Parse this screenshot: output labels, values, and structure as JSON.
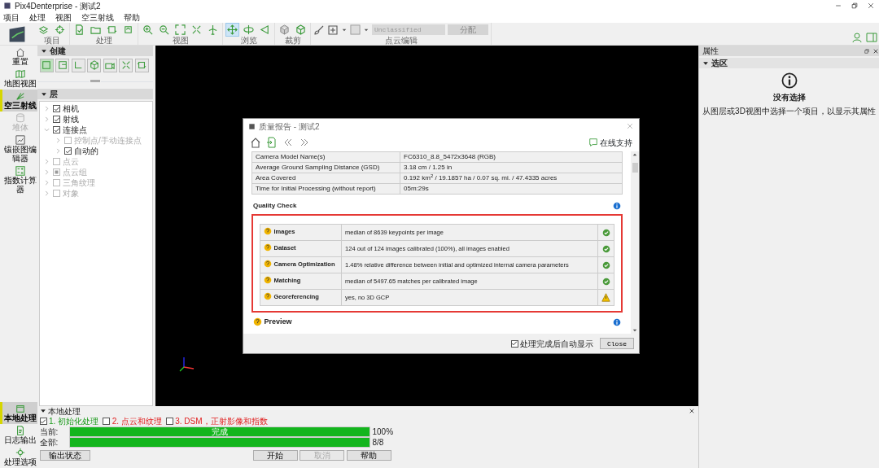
{
  "window": {
    "title": "Pix4Denterprise - 测试2"
  },
  "menu": [
    "项目",
    "处理",
    "视图",
    "空三射线",
    "帮助"
  ],
  "toolbar": {
    "groups": [
      {
        "label": "项目",
        "tools": [
          {
            "selected": false
          },
          {
            "selected": false
          }
        ]
      },
      {
        "label": "处理",
        "tools": [
          {
            "selected": false
          },
          {
            "selected": false
          },
          {
            "selected": false
          },
          {
            "selected": false
          }
        ]
      },
      {
        "label": "视图",
        "tools": [
          {
            "selected": false
          },
          {
            "selected": false
          },
          {
            "selected": false
          },
          {
            "selected": false
          },
          {
            "selected": false
          }
        ]
      },
      {
        "label": "浏览",
        "tools": [
          {
            "selected": true
          },
          {
            "selected": false
          },
          {
            "selected": false
          }
        ]
      },
      {
        "label": "裁剪",
        "tools": [
          {
            "selected": false
          },
          {
            "selected": false
          }
        ]
      }
    ],
    "edit_group": {
      "label": "点云编辑",
      "class_select": "Unclassified",
      "assign_button": "分配"
    }
  },
  "sidebar": {
    "top": [
      {
        "label": "重置",
        "selected": false,
        "disabled": false
      },
      {
        "label": "地图视图",
        "selected": false,
        "disabled": false
      },
      {
        "label": "空三射线",
        "selected": true,
        "disabled": false
      },
      {
        "label": "堆体",
        "selected": false,
        "disabled": true
      },
      {
        "label": "镶嵌图编辑器",
        "selected": false,
        "disabled": false
      },
      {
        "label": "指数计算器",
        "selected": false,
        "disabled": false
      }
    ],
    "bottom": [
      {
        "label": "本地处理",
        "selected": true,
        "disabled": false
      },
      {
        "label": "日志输出",
        "selected": false,
        "disabled": false
      },
      {
        "label": "处理选项",
        "selected": false,
        "disabled": false
      }
    ]
  },
  "create_panel": {
    "title": "创建",
    "tools": [
      {
        "selected": true
      },
      {
        "selected": false
      },
      {
        "selected": false
      },
      {
        "selected": false
      },
      {
        "selected": false
      },
      {
        "selected": false
      },
      {
        "selected": false
      }
    ]
  },
  "layers_panel": {
    "title": "层",
    "items": [
      {
        "label": "相机",
        "kind": "checkbox",
        "checked": true,
        "disabled": false,
        "expanded": false
      },
      {
        "label": "射线",
        "kind": "checkbox",
        "checked": true,
        "disabled": false,
        "expanded": false
      },
      {
        "label": "连接点",
        "kind": "checkbox",
        "checked": true,
        "disabled": false,
        "expanded": true,
        "children": [
          {
            "label": "控制点/手动连接点",
            "kind": "checkbox",
            "checked": false,
            "disabled": true,
            "expanded": false
          },
          {
            "label": "自动的",
            "kind": "checkbox",
            "checked": true,
            "disabled": false,
            "expanded": false
          }
        ]
      },
      {
        "label": "点云",
        "kind": "checkbox",
        "checked": false,
        "disabled": true,
        "expanded": false
      },
      {
        "label": "点云组",
        "kind": "partial",
        "disabled": true,
        "expanded": false
      },
      {
        "label": "三角纹理",
        "kind": "checkbox",
        "checked": false,
        "disabled": true,
        "expanded": false
      },
      {
        "label": "对象",
        "kind": "checkbox",
        "checked": false,
        "disabled": true,
        "expanded": false
      }
    ]
  },
  "properties_panel": {
    "title": "属性",
    "section": "选区",
    "heading": "没有选择",
    "message": "从图层或3D视图中选择一个项目，以显示其属性"
  },
  "processing_panel": {
    "title": "本地处理",
    "steps": [
      {
        "label": "1. 初始化处理",
        "checked": true,
        "done": true
      },
      {
        "label": "2. 点云和纹理",
        "checked": false,
        "done": false
      },
      {
        "label": "3. DSM，正射影像和指数",
        "checked": false,
        "done": false
      }
    ],
    "progress": [
      {
        "label": "当前:",
        "level": 1.0,
        "text": "完成",
        "reading": "100%"
      },
      {
        "label": "全部:",
        "level": 1.0,
        "reading": "8/8"
      }
    ],
    "output_button": "输出状态",
    "buttons": [
      {
        "label": "开始",
        "disabled": false
      },
      {
        "label": "取消",
        "disabled": true
      },
      {
        "label": "帮助",
        "disabled": false
      }
    ]
  },
  "dialog": {
    "title": "质量报告 - 测试2",
    "support_link": "在线支持",
    "summary_rows": [
      [
        "Camera Model Name(s)",
        "FC6310_8.8_5472x3648 (RGB)"
      ],
      [
        "Average Ground Sampling Distance (GSD)",
        "3.18 cm / 1.25 in"
      ],
      [
        "Area Covered",
        "0.192 km$^{2}$ / 19.1857 ha / 0.07 sq. mi. / 47.4335 acres"
      ],
      [
        "Time for Initial Processing (without report)",
        "05m:29s"
      ]
    ],
    "quality_check": {
      "title": "Quality Check",
      "rows": [
        {
          "name": "Images",
          "detail": "median of 8639 keypoints per image",
          "kind": "ok"
        },
        {
          "name": "Dataset",
          "detail": "124 out of 124 images calibrated (100%), all images enabled",
          "kind": "ok"
        },
        {
          "name": "Camera Optimization",
          "detail": "1.48% relative difference between initial and optimized internal camera parameters",
          "kind": "ok"
        },
        {
          "name": "Matching",
          "detail": "median of 5497.65 matches per calibrated image",
          "kind": "ok"
        },
        {
          "name": "Georeferencing",
          "detail": "yes, no 3D GCP",
          "kind": "warning"
        }
      ]
    },
    "preview_title": "Preview",
    "auto_show": {
      "label": "处理完成后自动显示",
      "checked": true
    },
    "close_button": "Close"
  }
}
